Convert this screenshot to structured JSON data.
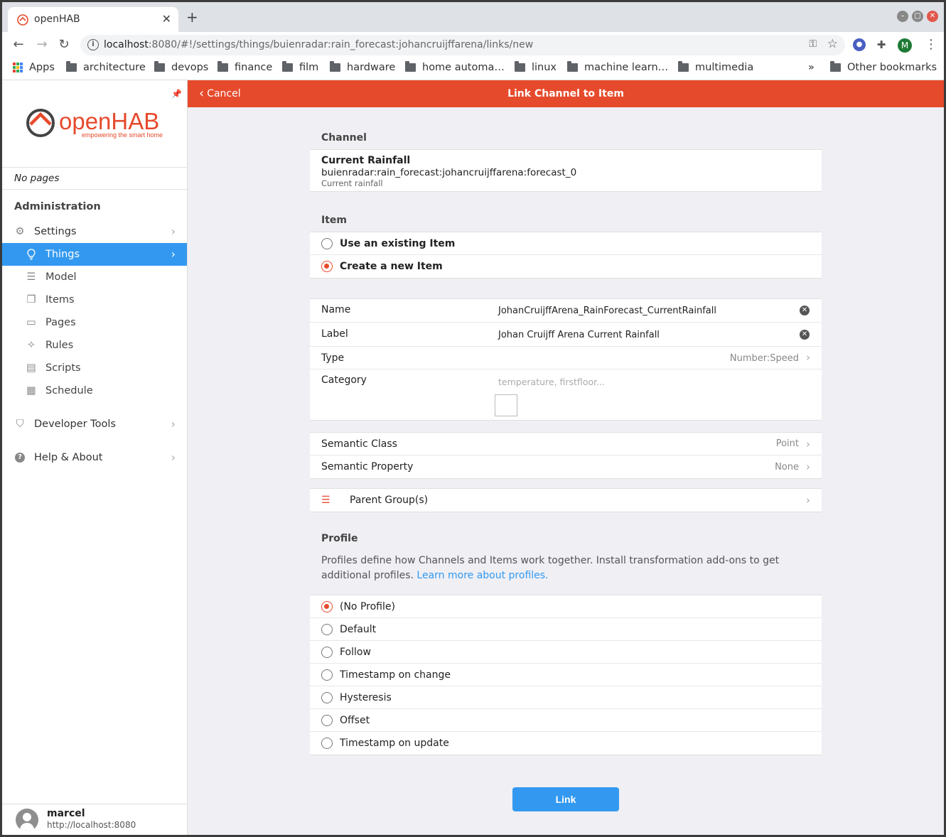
{
  "browser": {
    "tab_title": "openHAB",
    "tab_close": "✕",
    "new_tab": "+",
    "url_host": "localhost",
    "url_rest": ":8080/#!/settings/things/buienradar:rain_forecast:johancruijffarena/links/new",
    "profile_initial": "M",
    "bookmarks": [
      "Apps",
      "architecture",
      "devops",
      "finance",
      "film",
      "hardware",
      "home automa…",
      "linux",
      "machine learn…",
      "multimedia"
    ],
    "bookmarks_more": "»",
    "other_bookmarks": "Other bookmarks"
  },
  "sidebar": {
    "logo_text": "openHAB",
    "logo_tagline": "empowering the smart home",
    "no_pages": "No pages",
    "section_title": "Administration",
    "items": [
      {
        "label": "Settings",
        "icon": "gear-icon"
      },
      {
        "label": "Things",
        "icon": "lightbulb-icon"
      },
      {
        "label": "Model",
        "icon": "list-icon"
      },
      {
        "label": "Items",
        "icon": "copy-icon"
      },
      {
        "label": "Pages",
        "icon": "tv-icon"
      },
      {
        "label": "Rules",
        "icon": "wand-icon"
      },
      {
        "label": "Scripts",
        "icon": "doc-icon"
      },
      {
        "label": "Schedule",
        "icon": "calendar-icon"
      }
    ],
    "developer_tools": "Developer Tools",
    "help_about": "Help & About",
    "user_name": "marcel",
    "user_host": "http://localhost:8080"
  },
  "navbar": {
    "cancel": "Cancel",
    "title": "Link Channel to Item"
  },
  "channel": {
    "section_title": "Channel",
    "name": "Current Rainfall",
    "uid": "buienradar:rain_forecast:johancruijffarena:forecast_0",
    "description": "Current rainfall"
  },
  "item": {
    "section_title": "Item",
    "options": [
      "Use an existing Item",
      "Create a new Item"
    ],
    "selected": "Create a new Item",
    "fields": {
      "name_label": "Name",
      "name_value": "JohanCruijffArena_RainForecast_CurrentRainfall",
      "label_label": "Label",
      "label_value": "Johan Cruijff Arena Current Rainfall",
      "type_label": "Type",
      "type_value": "Number:Speed",
      "category_label": "Category",
      "category_placeholder": "temperature, firstfloor..."
    },
    "semantic_class_label": "Semantic Class",
    "semantic_class_value": "Point",
    "semantic_property_label": "Semantic Property",
    "semantic_property_value": "None",
    "parent_groups_label": "Parent Group(s)"
  },
  "profile": {
    "section_title": "Profile",
    "description": "Profiles define how Channels and Items work together. Install transformation add-ons to get additional profiles.",
    "learn_more": "Learn more about profiles.",
    "options": [
      "(No Profile)",
      "Default",
      "Follow",
      "Timestamp on change",
      "Hysteresis",
      "Offset",
      "Timestamp on update"
    ],
    "selected": "(No Profile)"
  },
  "actions": {
    "link": "Link"
  },
  "colors": {
    "brand": "#e64a2c",
    "accent": "#3399f0"
  }
}
